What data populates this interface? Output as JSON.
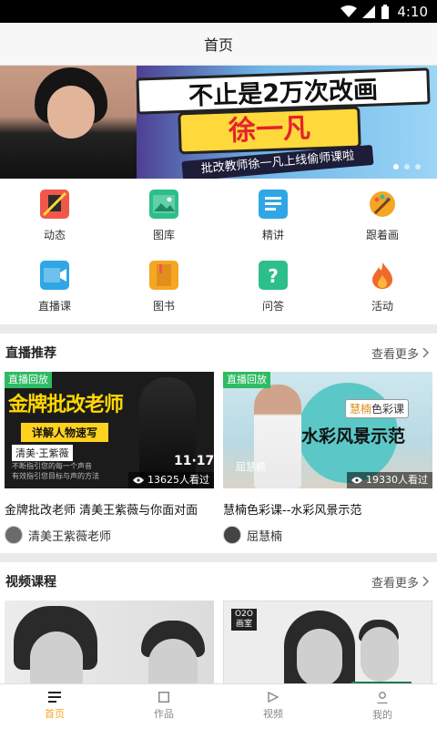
{
  "status_bar": {
    "time": "4:10"
  },
  "header": {
    "title": "首页"
  },
  "banner": {
    "headline": "不止是2万次改画",
    "name": "徐一凡",
    "subtitle": "批改教师徐一凡上线偷师课啦"
  },
  "grid": [
    {
      "label": "动态",
      "icon": "dynamic-icon",
      "color": "#f0574a"
    },
    {
      "label": "图库",
      "icon": "gallery-icon",
      "color": "#2cbf8a"
    },
    {
      "label": "精讲",
      "icon": "lecture-icon",
      "color": "#2fa6e6"
    },
    {
      "label": "跟着画",
      "icon": "palette-icon",
      "color": "#f5a623"
    },
    {
      "label": "直播课",
      "icon": "live-icon",
      "color": "#2fa6e6"
    },
    {
      "label": "图书",
      "icon": "book-icon",
      "color": "#f5a623"
    },
    {
      "label": "问答",
      "icon": "question-icon",
      "color": "#2cbf8a"
    },
    {
      "label": "活动",
      "icon": "fire-icon",
      "color": "#f06a2a"
    }
  ],
  "live_section": {
    "title": "直播推荐",
    "more": "查看更多",
    "cards": [
      {
        "badge": "直播回放",
        "thumb_title": "金牌批改老师",
        "thumb_highlight": "详解人物速写",
        "thumb_name": "清美·王紫薇",
        "thumb_date": "11·17",
        "thumb_text": "不断指引您的每一个声音\n有效指引您目标与声的方法",
        "views": "13625人看过",
        "title": "金牌批改老师 清美王紫薇与你面对面",
        "author": "清美王紫薇老师"
      },
      {
        "badge": "直播回放",
        "thumb_tag_a": "慧楠",
        "thumb_tag_b": "色彩课",
        "thumb_title": "水彩风景示范",
        "thumb_name": "屈慧楠",
        "views": "19330人看过",
        "title": "慧楠色彩课--水彩风景示范",
        "author": "屈慧楠"
      }
    ]
  },
  "video_section": {
    "title": "视频课程",
    "more": "查看更多",
    "cards": [
      {
        "tag": ""
      },
      {
        "tag": "O2O\n画室"
      }
    ]
  },
  "tabbar": [
    {
      "label": "首页",
      "icon": "home-icon",
      "active": true
    },
    {
      "label": "作品",
      "icon": "works-icon",
      "active": false
    },
    {
      "label": "视频",
      "icon": "video-icon",
      "active": false
    },
    {
      "label": "我的",
      "icon": "profile-icon",
      "active": false
    }
  ],
  "colors": {
    "accent": "#f5a623",
    "live_badge": "#2dbb63"
  }
}
